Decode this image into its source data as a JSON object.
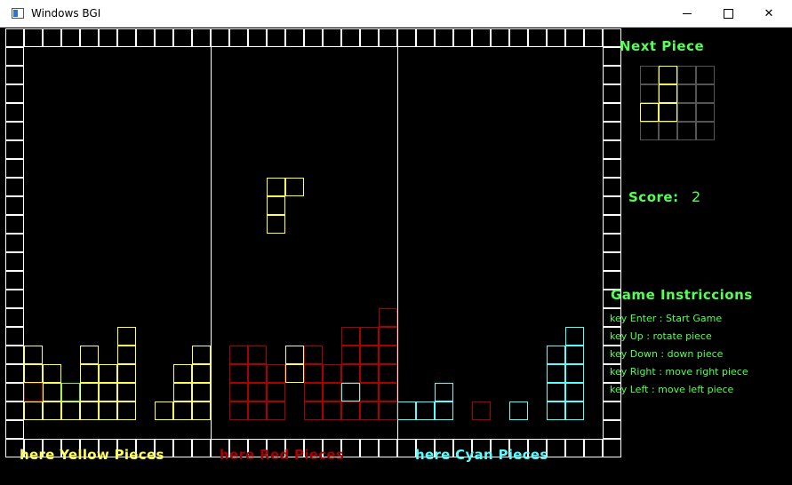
{
  "window": {
    "title": "Windows BGI"
  },
  "side_panel": {
    "next_piece_title": "Next Piece",
    "score_label": "Score:",
    "score_value": "2",
    "instructions_title": "Game Instriccions",
    "instructions": [
      "key Enter : Start Game",
      "key Up : rotate piece",
      "key Down : down piece",
      "key Right : move right piece",
      "key Left : move left piece"
    ]
  },
  "legend": {
    "yellow": "here Yellow Pieces",
    "red": "here Red Pieces",
    "cyan": "here Cyan Pieces"
  },
  "colors": {
    "yellow": "#ffff55",
    "red": "#aa0000",
    "cyan": "#55ffff",
    "green": "#55ff55",
    "border": "#ffffff",
    "grid": "#555555"
  },
  "next_piece": {
    "grid_cols": 4,
    "grid_rows": 4,
    "cells": [
      [
        1,
        0
      ],
      [
        1,
        1
      ],
      [
        0,
        2
      ],
      [
        1,
        2
      ]
    ],
    "color": "yellow"
  },
  "board": {
    "cols": 31,
    "rows": 21,
    "zone_dividers_after_col": [
      10,
      20
    ],
    "falling_piece": {
      "color": "yellow",
      "cells": [
        [
          14,
          8
        ],
        [
          15,
          8
        ],
        [
          14,
          9
        ],
        [
          14,
          10
        ]
      ]
    },
    "stacks": {
      "yellow": [
        [
          1,
          17
        ],
        [
          1,
          18
        ],
        [
          1,
          19
        ],
        [
          1,
          20
        ],
        [
          2,
          18
        ],
        [
          2,
          19
        ],
        [
          2,
          20
        ],
        [
          3,
          19
        ],
        [
          3,
          20
        ],
        [
          4,
          17
        ],
        [
          4,
          18
        ],
        [
          4,
          19
        ],
        [
          4,
          20
        ],
        [
          5,
          18
        ],
        [
          5,
          19
        ],
        [
          5,
          20
        ],
        [
          6,
          16
        ],
        [
          6,
          17
        ],
        [
          6,
          18
        ],
        [
          6,
          19
        ],
        [
          6,
          20
        ],
        [
          8,
          20
        ],
        [
          9,
          18
        ],
        [
          9,
          19
        ],
        [
          9,
          20
        ],
        [
          10,
          17
        ],
        [
          10,
          18
        ],
        [
          10,
          19
        ],
        [
          10,
          20
        ]
      ],
      "yellow_special": {
        "red": [
          [
            1,
            19
          ]
        ],
        "green": [
          [
            3,
            19
          ]
        ]
      },
      "red": [
        [
          12,
          17
        ],
        [
          12,
          18
        ],
        [
          12,
          19
        ],
        [
          12,
          20
        ],
        [
          13,
          17
        ],
        [
          13,
          18
        ],
        [
          13,
          19
        ],
        [
          13,
          20
        ],
        [
          14,
          18
        ],
        [
          14,
          19
        ],
        [
          14,
          20
        ],
        [
          16,
          17
        ],
        [
          16,
          18
        ],
        [
          16,
          19
        ],
        [
          16,
          20
        ],
        [
          17,
          18
        ],
        [
          17,
          19
        ],
        [
          17,
          20
        ],
        [
          18,
          16
        ],
        [
          18,
          17
        ],
        [
          18,
          18
        ],
        [
          18,
          19
        ],
        [
          18,
          20
        ],
        [
          19,
          16
        ],
        [
          19,
          17
        ],
        [
          19,
          18
        ],
        [
          19,
          19
        ],
        [
          19,
          20
        ],
        [
          20,
          15
        ],
        [
          20,
          16
        ],
        [
          20,
          17
        ],
        [
          20,
          18
        ],
        [
          20,
          19
        ],
        [
          20,
          20
        ]
      ],
      "red_special": {
        "yellow": [
          [
            15,
            17
          ],
          [
            15,
            18
          ]
        ],
        "cyan": [
          [
            18,
            19
          ]
        ]
      },
      "cyan": [
        [
          21,
          20
        ],
        [
          22,
          20
        ],
        [
          23,
          19
        ],
        [
          23,
          20
        ],
        [
          25,
          20
        ],
        [
          27,
          20
        ],
        [
          29,
          17
        ],
        [
          29,
          18
        ],
        [
          29,
          19
        ],
        [
          29,
          20
        ],
        [
          30,
          16
        ],
        [
          30,
          17
        ],
        [
          30,
          18
        ],
        [
          30,
          19
        ],
        [
          30,
          20
        ]
      ],
      "cyan_special": {
        "red": [
          [
            25,
            20
          ]
        ]
      }
    }
  }
}
